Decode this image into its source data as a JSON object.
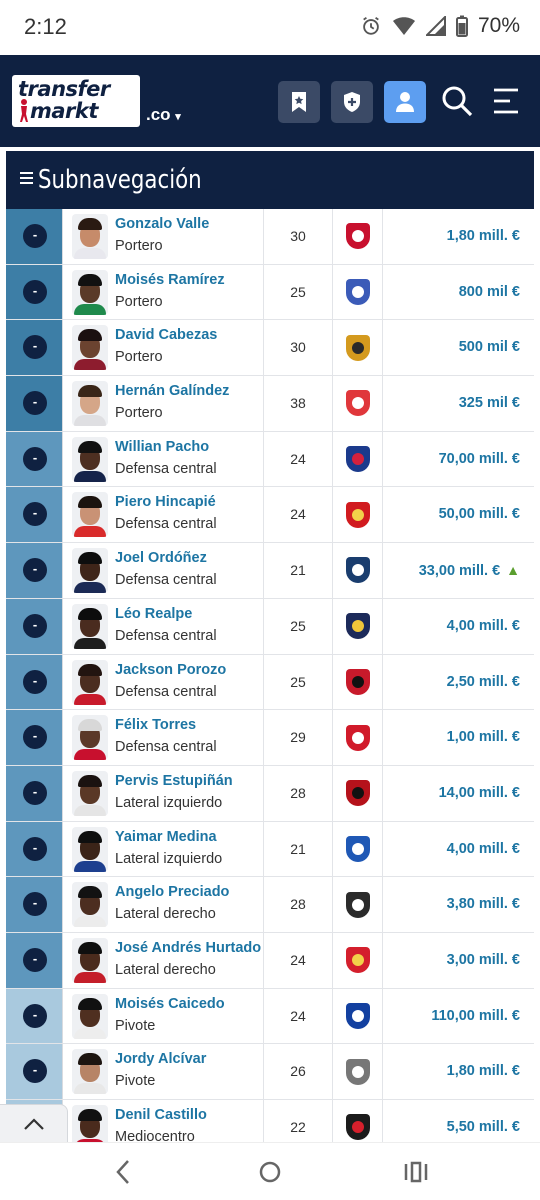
{
  "status": {
    "time": "2:12",
    "battery": "70%",
    "icons": [
      "alarm-icon",
      "wifi-icon",
      "signal-icon",
      "battery-icon"
    ]
  },
  "header": {
    "logo_line1": "transfer",
    "logo_line2": "markt",
    "domain": ".co",
    "buttons": [
      "bookmark-icon",
      "shield-plus-icon",
      "user-icon",
      "search-icon",
      "menu-icon"
    ]
  },
  "subnav": {
    "label": "Subnavegación"
  },
  "colors": {
    "navy": "#0f2141",
    "link": "#1d75a3",
    "active": "#5d9ef0",
    "trend_up": "#5a9e2e"
  },
  "players": [
    {
      "name": "Gonzalo Valle",
      "role": "Portero",
      "age": "30",
      "value": "1,80 mill. €",
      "pos_shade": "#3d7ea6",
      "skin": "#c68b6a",
      "hair": "#2a1a12",
      "shirt": "#e8e8ee",
      "crest": "#c8102e",
      "crest_inner": "#ffffff",
      "trend": ""
    },
    {
      "name": "Moisés Ramírez",
      "role": "Portero",
      "age": "25",
      "value": "800 mil €",
      "pos_shade": "#3d7ea6",
      "skin": "#5a3a28",
      "hair": "#111111",
      "shirt": "#1f8a4c",
      "crest": "#3b5bb8",
      "crest_inner": "#ffffff",
      "trend": ""
    },
    {
      "name": "David Cabezas",
      "role": "Portero",
      "age": "30",
      "value": "500 mil €",
      "pos_shade": "#3d7ea6",
      "skin": "#6b4330",
      "hair": "#1b1010",
      "shirt": "#8d1c2e",
      "crest": "#d49a1e",
      "crest_inner": "#2a2a2a",
      "trend": ""
    },
    {
      "name": "Hernán Galíndez",
      "role": "Portero",
      "age": "38",
      "value": "325 mil €",
      "pos_shade": "#3d7ea6",
      "skin": "#d5a688",
      "hair": "#3a2618",
      "shirt": "#dfdfe2",
      "crest": "#e0373b",
      "crest_inner": "#ffffff",
      "trend": ""
    },
    {
      "name": "Willian Pacho",
      "role": "Defensa central",
      "age": "24",
      "value": "70,00 mill. €",
      "pos_shade": "#5e97bd",
      "skin": "#4d2f21",
      "hair": "#111111",
      "shirt": "#15234a",
      "crest": "#1b3a8c",
      "crest_inner": "#d4213d",
      "trend": ""
    },
    {
      "name": "Piero Hincapié",
      "role": "Defensa central",
      "age": "24",
      "value": "50,00 mill. €",
      "pos_shade": "#5e97bd",
      "skin": "#c99275",
      "hair": "#1c130e",
      "shirt": "#d92b2b",
      "crest": "#d11b1f",
      "crest_inner": "#f2d14a",
      "trend": ""
    },
    {
      "name": "Joel Ordóñez",
      "role": "Defensa central",
      "age": "21",
      "value": "33,00 mill. €",
      "pos_shade": "#5e97bd",
      "skin": "#3f2519",
      "hair": "#0e0e0e",
      "shirt": "#1b2a55",
      "crest": "#1a3d6e",
      "crest_inner": "#ffffff",
      "trend": "▲"
    },
    {
      "name": "Léo Realpe",
      "role": "Defensa central",
      "age": "25",
      "value": "4,00 mill. €",
      "pos_shade": "#5e97bd",
      "skin": "#4a2c1f",
      "hair": "#0d0d0d",
      "shirt": "#1e1e1e",
      "crest": "#1c2a5a",
      "crest_inner": "#f0c63a",
      "trend": ""
    },
    {
      "name": "Jackson Porozo",
      "role": "Defensa central",
      "age": "25",
      "value": "2,50 mill. €",
      "pos_shade": "#5e97bd",
      "skin": "#4b2d20",
      "hair": "#221410",
      "shirt": "#c81a2b",
      "crest": "#c81a2b",
      "crest_inner": "#111111",
      "trend": ""
    },
    {
      "name": "Félix Torres",
      "role": "Defensa central",
      "age": "29",
      "value": "1,00 mill. €",
      "pos_shade": "#5e97bd",
      "skin": "#5b3828",
      "hair": "#d8d8d8",
      "shirt": "#c8102e",
      "crest": "#d11a2a",
      "crest_inner": "#ffffff",
      "trend": ""
    },
    {
      "name": "Pervis Estupiñán",
      "role": "Lateral izquierdo",
      "age": "28",
      "value": "14,00 mill. €",
      "pos_shade": "#5e97bd",
      "skin": "#5a3826",
      "hair": "#1a1210",
      "shirt": "#e5e5e5",
      "crest": "#b5121b",
      "crest_inner": "#111111",
      "trend": ""
    },
    {
      "name": "Yaimar Medina",
      "role": "Lateral izquierdo",
      "age": "21",
      "value": "4,00 mill. €",
      "pos_shade": "#5e97bd",
      "skin": "#3b2418",
      "hair": "#0f0f0f",
      "shirt": "#1d3f8f",
      "crest": "#1f58b5",
      "crest_inner": "#ffffff",
      "trend": ""
    },
    {
      "name": "Angelo Preciado",
      "role": "Lateral derecho",
      "age": "28",
      "value": "3,80 mill. €",
      "pos_shade": "#5e97bd",
      "skin": "#4c2e20",
      "hair": "#121212",
      "shirt": "#ececec",
      "crest": "#2b2b2b",
      "crest_inner": "#ffffff",
      "trend": ""
    },
    {
      "name": "José Andrés Hurtado",
      "role": "Lateral derecho",
      "age": "24",
      "value": "3,00 mill. €",
      "pos_shade": "#5e97bd",
      "skin": "#4a2b1d",
      "hair": "#0f0f0f",
      "shirt": "#c41e2a",
      "crest": "#d41f2d",
      "crest_inner": "#f2d14a",
      "trend": ""
    },
    {
      "name": "Moisés Caicedo",
      "role": "Pivote",
      "age": "24",
      "value": "110,00 mill. €",
      "pos_shade": "#a9c9de",
      "skin": "#4f2f20",
      "hair": "#111111",
      "shirt": "#ededed",
      "crest": "#1340a0",
      "crest_inner": "#ffffff",
      "trend": ""
    },
    {
      "name": "Jordy Alcívar",
      "role": "Pivote",
      "age": "26",
      "value": "1,80 mill. €",
      "pos_shade": "#a9c9de",
      "skin": "#b78466",
      "hair": "#1d1510",
      "shirt": "#e8e8e8",
      "crest": "#777777",
      "crest_inner": "#ffffff",
      "trend": ""
    },
    {
      "name": "Denil Castillo",
      "role": "Mediocentro",
      "age": "22",
      "value": "5,50 mill. €",
      "pos_shade": "#a9c9de",
      "skin": "#4a2b1d",
      "hair": "#111111",
      "shirt": "#c8102e",
      "crest": "#1b1b1b",
      "crest_inner": "#d6202c",
      "trend": ""
    }
  ]
}
